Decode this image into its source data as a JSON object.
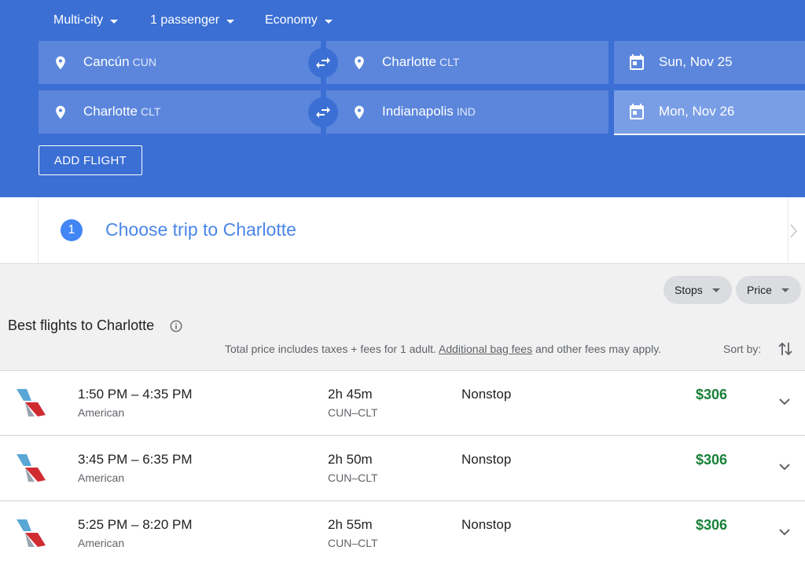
{
  "options": {
    "trip_type": "Multi-city",
    "passengers": "1 passenger",
    "cabin": "Economy"
  },
  "legs": [
    {
      "origin_city": "Cancún",
      "origin_code": "CUN",
      "dest_city": "Charlotte",
      "dest_code": "CLT",
      "date": "Sun, Nov 25"
    },
    {
      "origin_city": "Charlotte",
      "origin_code": "CLT",
      "dest_city": "Indianapolis",
      "dest_code": "IND",
      "date": "Mon, Nov 26"
    }
  ],
  "add_flight_label": "ADD FLIGHT",
  "step": {
    "number": "1",
    "title": "Choose trip to Charlotte"
  },
  "filters": {
    "stops": "Stops",
    "price": "Price"
  },
  "results": {
    "title": "Best flights to Charlotte",
    "disclaimer_pre": "Total price includes taxes + fees for 1 adult. ",
    "disclaimer_link": "Additional bag fees",
    "disclaimer_post": " and other fees may apply.",
    "sort_label": "Sort by:"
  },
  "flights": [
    {
      "times": "1:50 PM – 4:35 PM",
      "airline": "American",
      "duration": "2h 45m",
      "route": "CUN–CLT",
      "stops": "Nonstop",
      "price": "$306"
    },
    {
      "times": "3:45 PM – 6:35 PM",
      "airline": "American",
      "duration": "2h 50m",
      "route": "CUN–CLT",
      "stops": "Nonstop",
      "price": "$306"
    },
    {
      "times": "5:25 PM – 8:20 PM",
      "airline": "American",
      "duration": "2h 55m",
      "route": "CUN–CLT",
      "stops": "Nonstop",
      "price": "$306"
    }
  ],
  "colors": {
    "header": "#3b6fd4",
    "field": "#5b86dc",
    "price": "#188038",
    "step_title": "#4a86e8"
  },
  "icons": {
    "location": "location-pin-icon",
    "swap": "swap-arrows-icon",
    "calendar": "calendar-icon",
    "info": "info-icon",
    "sort": "sort-arrows-icon",
    "expand": "chevron-down-icon",
    "airline": "american-airlines-logo"
  }
}
